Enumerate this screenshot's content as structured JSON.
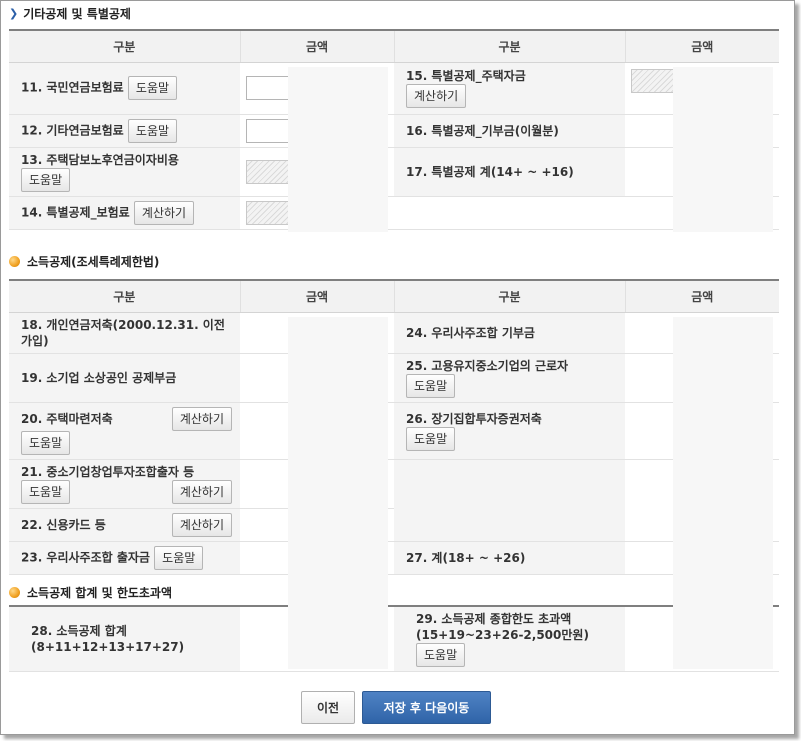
{
  "sections": {
    "other": "기타공제 및 특별공제",
    "income": "소득공제(조세특례제한법)",
    "total": "소득공제 합계 및 한도초과액"
  },
  "headers": {
    "gubun": "구분",
    "amount": "금액"
  },
  "buttons": {
    "help": "도움말",
    "calc": "계산하기",
    "prev": "이전",
    "save_next": "저장 후 다음이동"
  },
  "other_rows": {
    "r11": "11. 국민연금보험료",
    "r12": "12. 기타연금보험료",
    "r13": "13. 주택담보노후연금이자비용",
    "r14": "14. 특별공제_보험료",
    "r15": "15. 특별공제_주택자금",
    "r16": "16. 특별공제_기부금(이월분)",
    "r17": "17. 특별공제 계(14+ ~ +16)"
  },
  "income_rows": {
    "r18": "18. 개인연금저축(2000.12.31. 이전 가입)",
    "r19": "19. 소기업 소상공인 공제부금",
    "r20": "20. 주택마련저축",
    "r21": "21. 중소기업창업투자조합출자 등",
    "r22": "22. 신용카드 등",
    "r23": "23. 우리사주조합 출자금",
    "r24": "24. 우리사주조합 기부금",
    "r25": "25. 고용유지중소기업의 근로자",
    "r26": "26. 장기집합투자증권저축",
    "r27": "27. 계(18+ ~ +26)"
  },
  "total_rows": {
    "r28": "28. 소득공제 합계(8+11+12+13+17+27)",
    "r29": "29. 소득공제 종합한도 초과액(15+19~23+26-2,500만원)"
  }
}
